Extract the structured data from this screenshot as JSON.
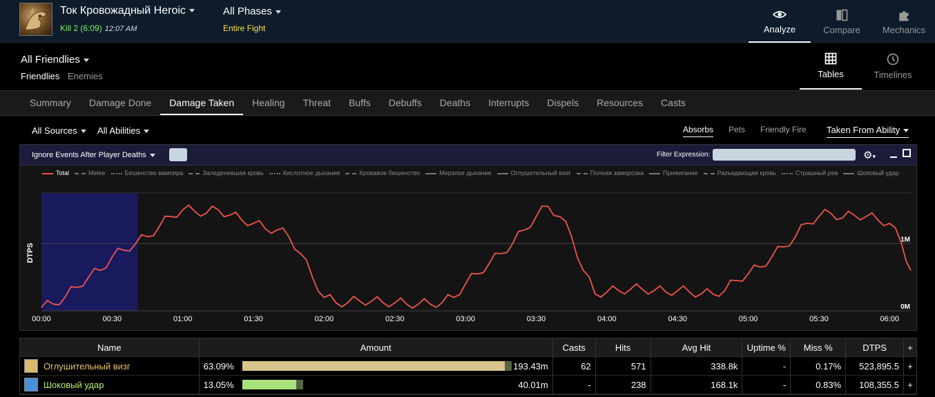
{
  "header": {
    "encounter": "Ток Кровожадный Heroic",
    "kill": "Kill 2 (6:09)",
    "time": "12:07 AM",
    "phase": "All Phases",
    "phase_sub": "Entire Fight",
    "nav": [
      {
        "label": "Analyze",
        "icon": "eye-icon"
      },
      {
        "label": "Compare",
        "icon": "compare-icon"
      },
      {
        "label": "Mechanics",
        "icon": "puzzle-icon"
      }
    ]
  },
  "sub": {
    "title": "All Friendlies",
    "tab_active": "Friendlies",
    "tab_other": "Enemies",
    "views": [
      {
        "label": "Tables",
        "icon": "grid-icon"
      },
      {
        "label": "Timelines",
        "icon": "clock-icon"
      }
    ]
  },
  "tabs": [
    "Summary",
    "Damage Done",
    "Damage Taken",
    "Healing",
    "Threat",
    "Buffs",
    "Debuffs",
    "Deaths",
    "Interrupts",
    "Dispels",
    "Resources",
    "Casts"
  ],
  "filters": {
    "sources": "All Sources",
    "abilities": "All Abilities",
    "absorbs": "Absorbs",
    "pets": "Pets",
    "friendly_fire": "Friendly Fire",
    "taken_from": "Taken From Ability"
  },
  "chart_toolbar": {
    "ignore": "Ignore Events After Player Deaths",
    "filter_label": "Filter Expression:"
  },
  "chart_data": {
    "type": "line",
    "ylabel": "DTPS",
    "y_ticks": [
      "1M",
      "0M"
    ],
    "x_ticks": [
      "00:00",
      "00:30",
      "01:00",
      "01:30",
      "02:00",
      "02:30",
      "03:00",
      "03:30",
      "04:00",
      "04:30",
      "05:00",
      "05:30",
      "06:00"
    ],
    "legend": [
      "Total",
      "Melee",
      "Бешенство вампира",
      "Заледеневшая кровь",
      "Кислотное дыхание",
      "Кровавое бешенство",
      "Мерзлое дыхание",
      "Оглушительный визг",
      "Полная заморозка",
      "Прижигание",
      "Разъедающая кровь",
      "Страшный рев",
      "Шоковый удар"
    ],
    "series": [
      {
        "name": "Total",
        "color": "#f0554a",
        "t": [
          0,
          5,
          10,
          15,
          20,
          25,
          30,
          35,
          40,
          45,
          50,
          55,
          60,
          65,
          70,
          75,
          80,
          85,
          90,
          95,
          100,
          105,
          110,
          115,
          120,
          125,
          130,
          135,
          140,
          145,
          150,
          155,
          160,
          165,
          170,
          175,
          180,
          185,
          190,
          195,
          200,
          205,
          210,
          215,
          220,
          225,
          230,
          235,
          240,
          245,
          250,
          255,
          260,
          265,
          270,
          275,
          280,
          285,
          290,
          295,
          300,
          305,
          310,
          315,
          320,
          325,
          330,
          335,
          340,
          345,
          350,
          355,
          360,
          365,
          369
        ],
        "v": [
          0.05,
          0.1,
          0.2,
          0.35,
          0.5,
          0.6,
          0.8,
          0.9,
          1.0,
          1.1,
          1.25,
          1.4,
          1.5,
          1.48,
          1.45,
          1.5,
          1.42,
          1.35,
          1.3,
          1.22,
          1.2,
          1.1,
          0.85,
          0.5,
          0.2,
          0.12,
          0.12,
          0.15,
          0.14,
          0.12,
          0.12,
          0.1,
          0.1,
          0.1,
          0.12,
          0.2,
          0.4,
          0.55,
          0.7,
          0.85,
          1.0,
          1.2,
          1.4,
          1.55,
          1.4,
          1.1,
          0.6,
          0.25,
          0.28,
          0.3,
          0.32,
          0.32,
          0.3,
          0.28,
          0.3,
          0.28,
          0.25,
          0.25,
          0.3,
          0.45,
          0.55,
          0.65,
          0.8,
          0.95,
          1.1,
          1.3,
          1.4,
          1.45,
          1.38,
          1.42,
          1.4,
          1.35,
          1.3,
          1.0,
          0.6
        ]
      }
    ],
    "highlight_range": [
      0,
      41
    ]
  },
  "table": {
    "columns": [
      "Name",
      "Amount",
      "Casts",
      "Hits",
      "Avg Hit",
      "Uptime %",
      "Miss %",
      "DTPS",
      "+"
    ],
    "rows": [
      {
        "name": "Оглушительный визг",
        "color": "#e8c86a",
        "icon_color": "#d9b870",
        "pct": "63.09%",
        "bar_fraction": 0.6309,
        "bar_color": "#d9c58c",
        "amount": "193.43m",
        "casts": "62",
        "hits": "571",
        "avg_hit": "338.8k",
        "uptime": "-",
        "miss": "0.17%",
        "dtps": "523,895.5",
        "plus": "+"
      },
      {
        "name": "Шоковый удар",
        "color": "#b7f26a",
        "icon_color": "#4a90d9",
        "pct": "13.05%",
        "bar_fraction": 0.1305,
        "bar_color": "#a8e07a",
        "amount": "40.01m",
        "casts": "-",
        "hits": "238",
        "avg_hit": "168.1k",
        "uptime": "-",
        "miss": "0.83%",
        "dtps": "108,355.5",
        "plus": "+"
      }
    ]
  }
}
